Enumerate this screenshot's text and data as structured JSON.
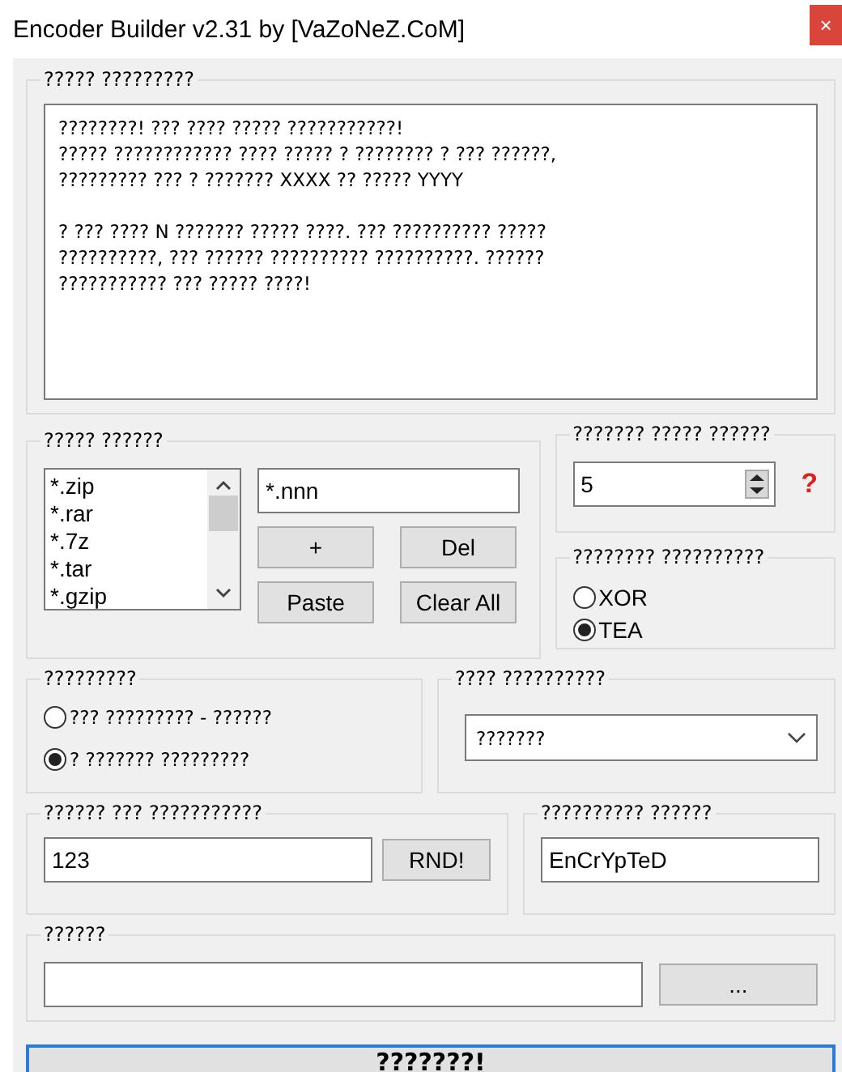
{
  "window": {
    "title": "Encoder Builder v2.31 by [VaZoNeZ.CoM]",
    "close": "×"
  },
  "message_group": {
    "label": "????? ?????????",
    "text": "????????! ??? ???? ????? ???????????!\n????? ???????????? ???? ????? ? ???????? ? ??? ??????,\n????????? ??? ? ??????? XXXX ?? ????? YYYY\n\n? ??? ???? N ??????? ????? ????. ??? ?????????? ?????\n??????????, ??? ?????? ?????????? ??????????. ??????\n??????????? ??? ????? ????!"
  },
  "extensions_group": {
    "label": "????? ??????",
    "items": [
      "*.zip",
      "*.rar",
      "*.7z",
      "*.tar",
      "*.gzip"
    ],
    "input": "*.nnn",
    "buttons": [
      "+",
      "Del",
      "Paste",
      "Clear All"
    ]
  },
  "count_group": {
    "label": "??????? ????? ??????",
    "value": "5",
    "help": "?"
  },
  "algorithm_group": {
    "label": "???????? ??????????",
    "options": [
      {
        "label": "XOR",
        "selected": false
      },
      {
        "label": "TEA",
        "selected": true
      }
    ]
  },
  "mode_group": {
    "label": "?????????",
    "options": [
      {
        "label": "??? ????????? - ??????",
        "selected": false
      },
      {
        "label": "? ??????? ?????????",
        "selected": true
      }
    ]
  },
  "type_group": {
    "label": "???? ??????????",
    "value": "???????"
  },
  "password_group": {
    "label": "?????? ??? ???????????",
    "value": "123",
    "button": "RND!"
  },
  "suffix_group": {
    "label": "?????????? ??????",
    "value": "EnCrYpTeD"
  },
  "path_group": {
    "label": "??????",
    "button": "..."
  },
  "build_button": "???????!"
}
